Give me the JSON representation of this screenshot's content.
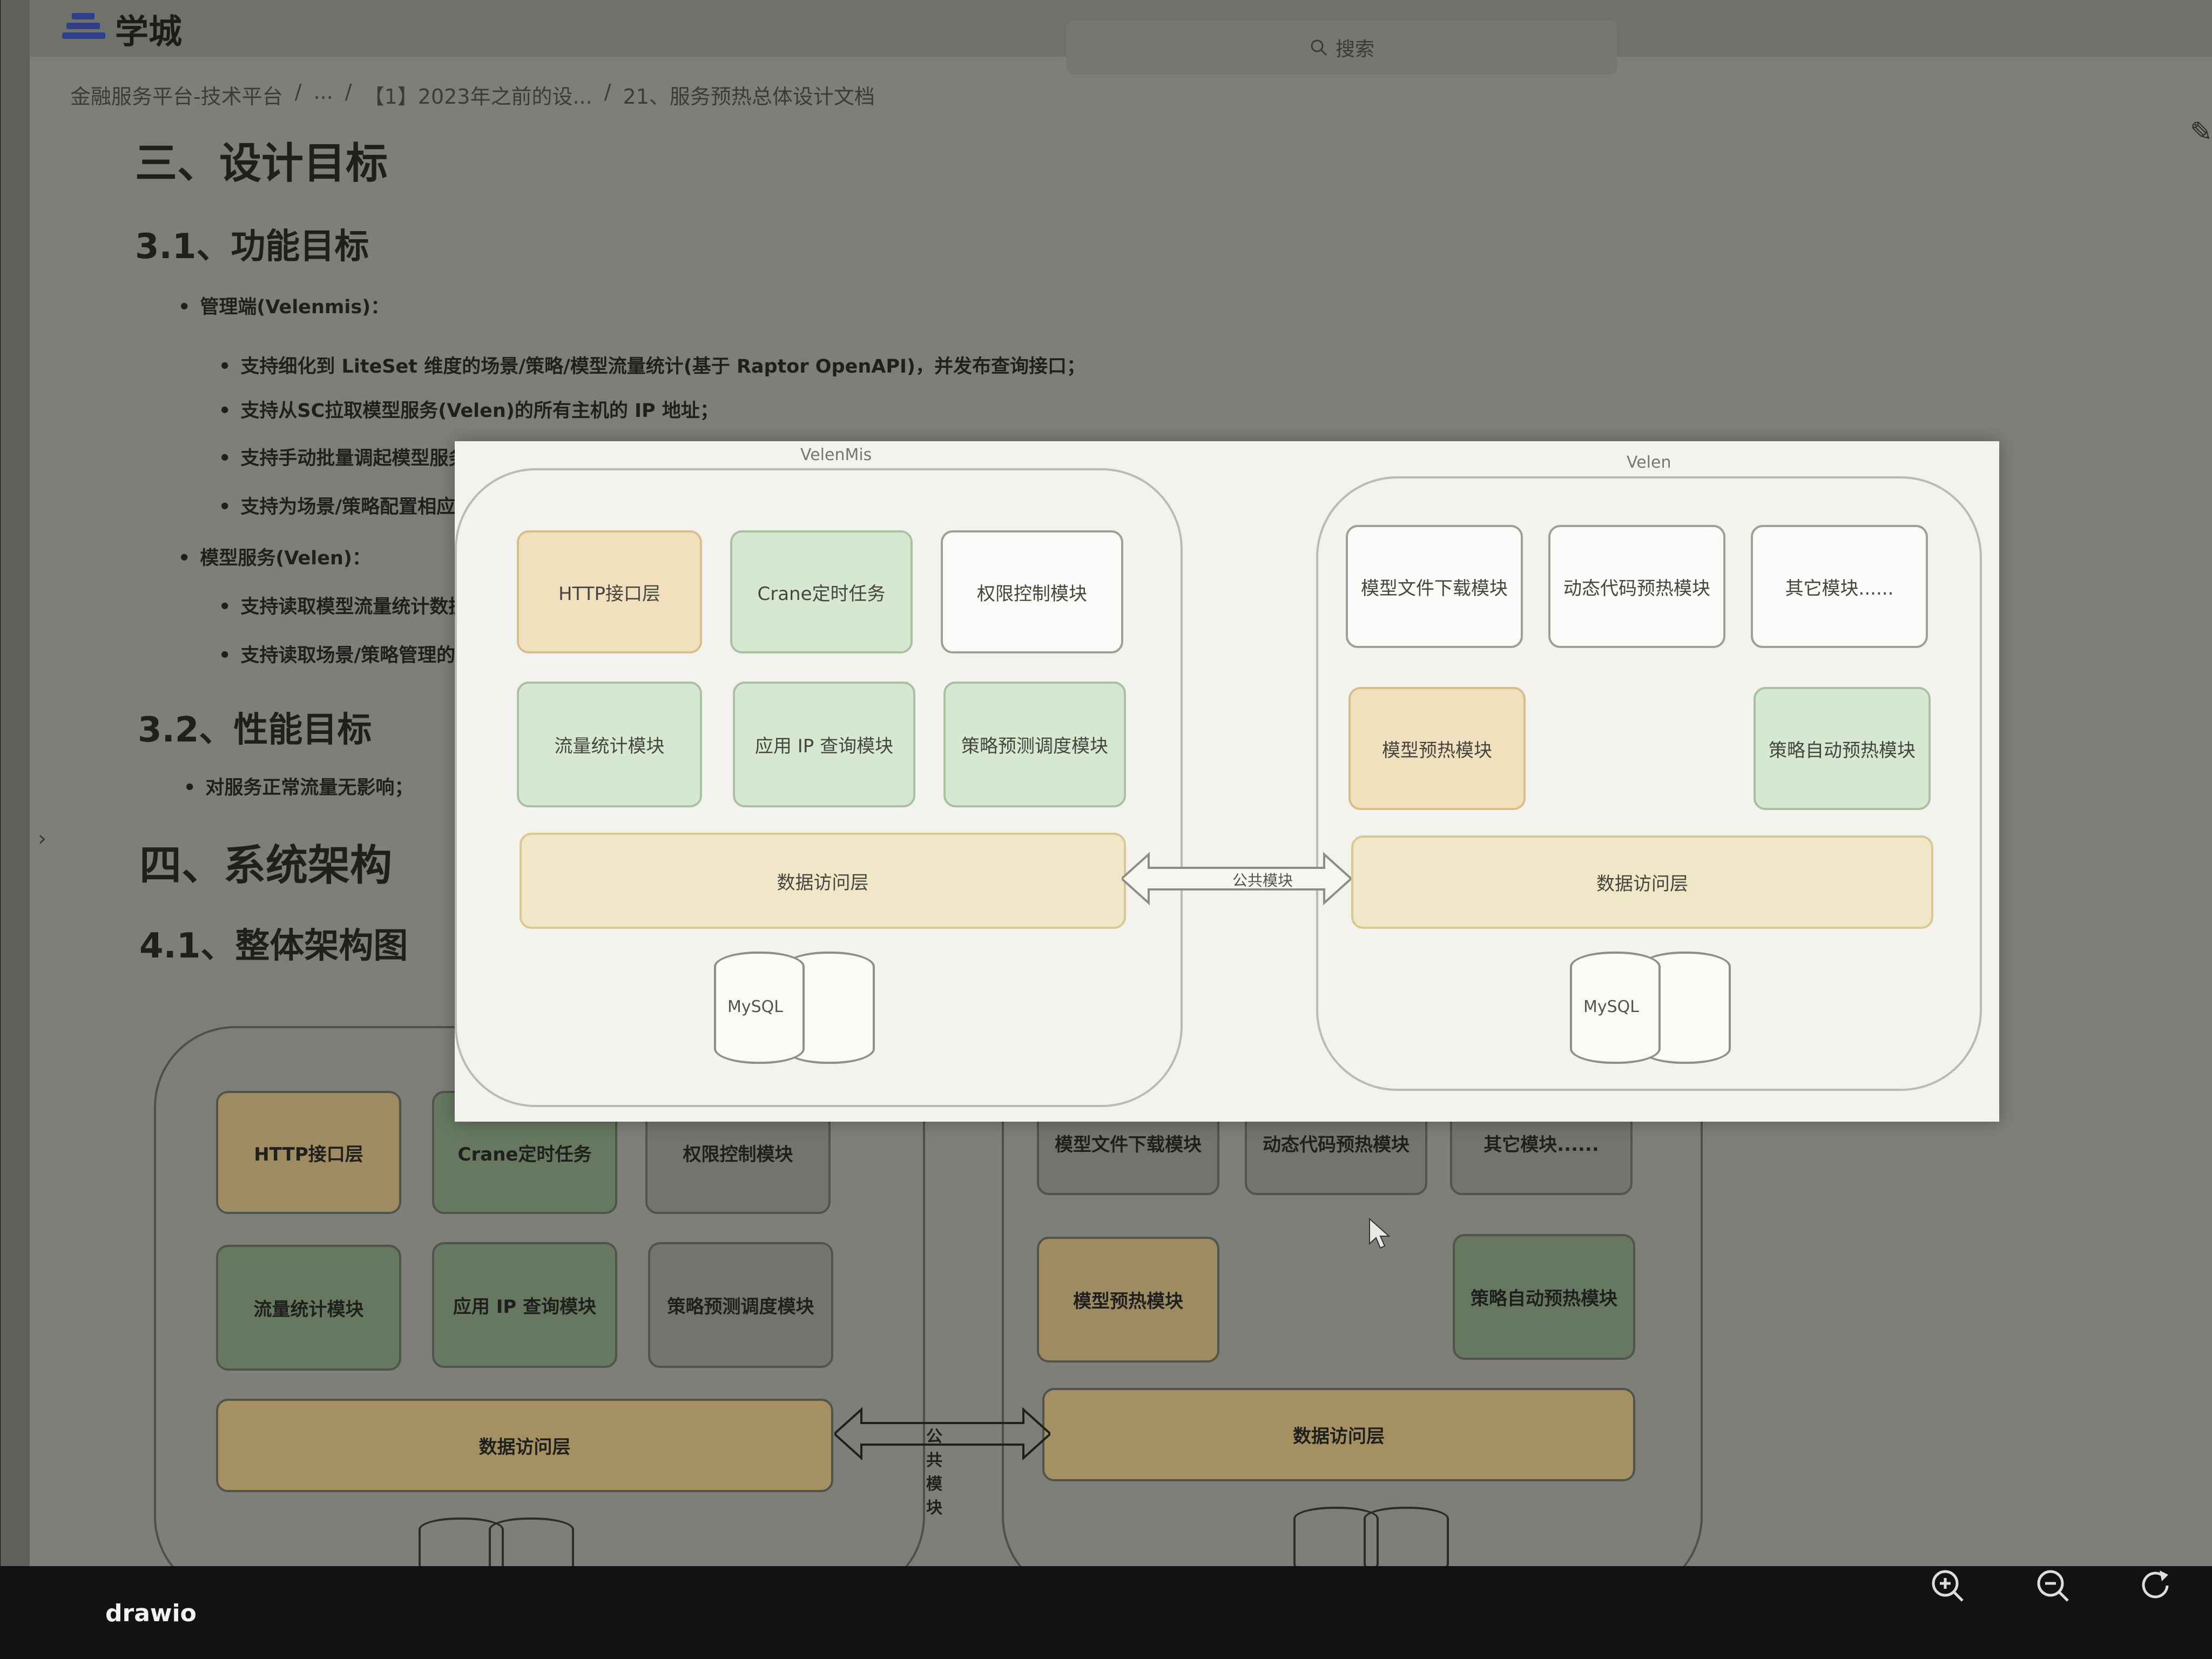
{
  "app": {
    "name": "学城"
  },
  "search": {
    "placeholder": "搜索"
  },
  "breadcrumb": {
    "items": [
      "金融服务平台-技术平台",
      "/",
      "...",
      "/",
      "【1】2023年之前的设...",
      "/",
      "21、服务预热总体设计文档"
    ]
  },
  "doc": {
    "h_goal": "三、设计目标",
    "h_func": "3.1、功能目标",
    "admin_label": "管理端(Velenmis)：",
    "admin_items": [
      "支持细化到 LiteSet 维度的场景/策略/模型流量统计(基于 Raptor OpenAPI)，并发布查询接口；",
      "支持从SC拉取模型服务(Velen)的所有主机的 IP 地址；",
      "支持手动批量调起模型服务(",
      "支持为场景/策略配置相应的"
    ],
    "model_label": "模型服务(Velen)：",
    "model_items": [
      "支持读取模型流量统计数据",
      "支持读取场景/策略管理的请"
    ],
    "h_perf": "3.2、性能目标",
    "perf_items": [
      "对服务正常流量无影响；"
    ],
    "h_arch": "四、系统架构",
    "h_arch_sub": "4.1、整体架构图"
  },
  "diagram": {
    "left_title": "VelenMis",
    "right_title": "Velen",
    "left_boxes": [
      "HTTP接口层",
      "Crane定时任务",
      "权限控制模块",
      "流量统计模块",
      "应用 IP 查询模块",
      "策略预测调度模块"
    ],
    "right_boxes": [
      "模型文件下载模块",
      "动态代码预热模块",
      "其它模块......",
      "模型预热模块",
      "策略自动预热模块"
    ],
    "data_layer": "数据访问层",
    "common": "公共模块",
    "db": "MySQL"
  },
  "bg_diagram": {
    "left_boxes": [
      "HTTP接口层",
      "Crane定时任务",
      "权限控制模块",
      "流量统计模块",
      "应用 IP 查询模块",
      "策略预测调度模块"
    ],
    "right_boxes": [
      "模型文件下载模块",
      "动态代码预热模块",
      "其它模块......",
      "模型预热模块",
      "策略自动预热模块"
    ],
    "data_layer": "数据访问层",
    "common": "公共模块"
  },
  "toolbar": {
    "brand": "drawio",
    "icons": [
      "zoom-in-icon",
      "zoom-out-icon",
      "reset-icon"
    ]
  }
}
